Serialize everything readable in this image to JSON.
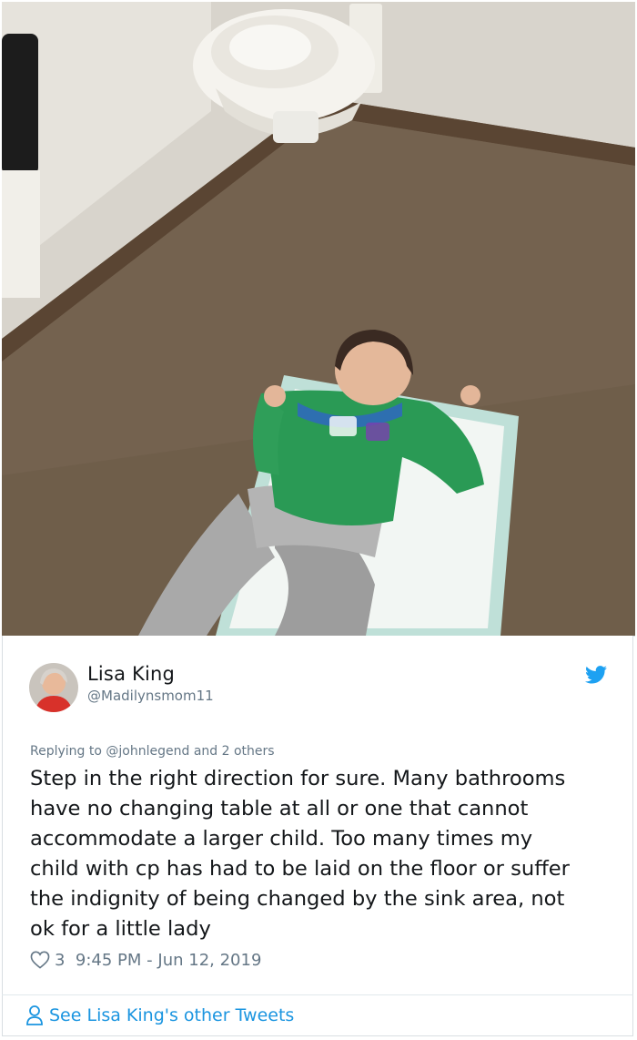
{
  "photo": {
    "alt_subject": "child lying on changing pad on restroom floor next to toilet"
  },
  "author": {
    "name": "Lisa King",
    "handle": "@Madilynsmom11"
  },
  "reply": {
    "prefix": "Replying to",
    "mention": "@johnlegend",
    "suffix": "and 2 others"
  },
  "tweet": {
    "lines": [
      "Step in the right direction for sure. Many bathrooms",
      "have no changing table at all or one that cannot",
      "accommodate a larger child. Too many times my",
      "child with cp has had to be laid on the floor or suffer",
      "the indignity of being changed by the sink area, not",
      "ok for a little lady"
    ]
  },
  "meta": {
    "likes": "3",
    "time": "9:45 PM",
    "separator": " - ",
    "date": "Jun 12, 2019"
  },
  "footer": {
    "see_more": "See Lisa King's other Tweets"
  },
  "icons": {
    "heart": "heart-icon",
    "bird": "twitter-bird-icon",
    "person": "person-icon"
  },
  "colors": {
    "text": "#14171a",
    "muted": "#657786",
    "twitter_blue": "#1da1f2",
    "link_blue": "#1b95e0",
    "border": "#d9dee2"
  }
}
